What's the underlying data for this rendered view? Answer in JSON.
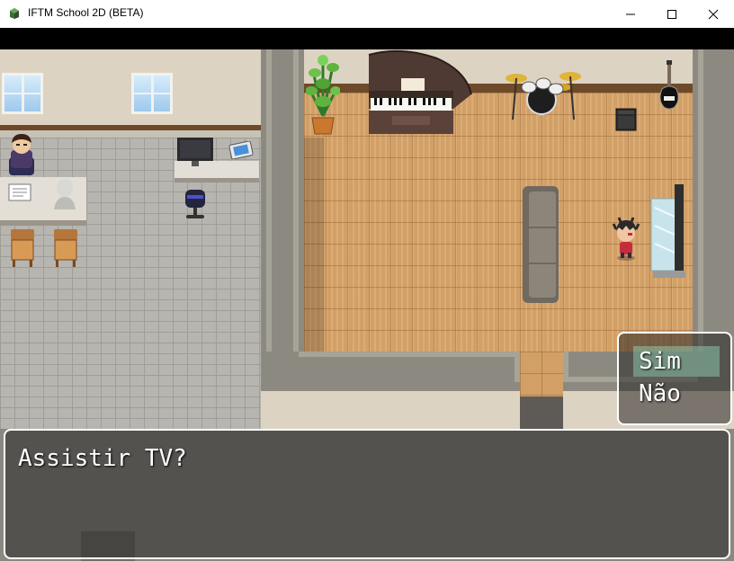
{
  "window": {
    "title": "IFTM School 2D (BETA)",
    "controls": {
      "minimize": "minimize-icon",
      "maximize": "maximize-icon",
      "close": "close-icon"
    }
  },
  "scene": {
    "rooms": [
      "stone-floor-office",
      "wood-floor-music-room"
    ],
    "objects": [
      "window-icon",
      "teacher-character",
      "desk-icon",
      "bust-statue-icon",
      "chair-icon",
      "monitor-icon",
      "tablet-icon",
      "office-chair-icon",
      "potted-plant-icon",
      "grand-piano-icon",
      "drum-kit-icon",
      "amplifier-icon",
      "guitar-icon",
      "sofa-icon",
      "tv-icon",
      "player-character"
    ]
  },
  "dialog": {
    "message": "Assistir TV?",
    "choices": [
      "Sim",
      "Não"
    ],
    "selected_choice": "Sim"
  },
  "colors": {
    "titlebar_bg": "#ffffff",
    "dialog_border": "#ffffff",
    "dialog_text": "#ffffff",
    "selection_highlight": "#96dcbe"
  }
}
